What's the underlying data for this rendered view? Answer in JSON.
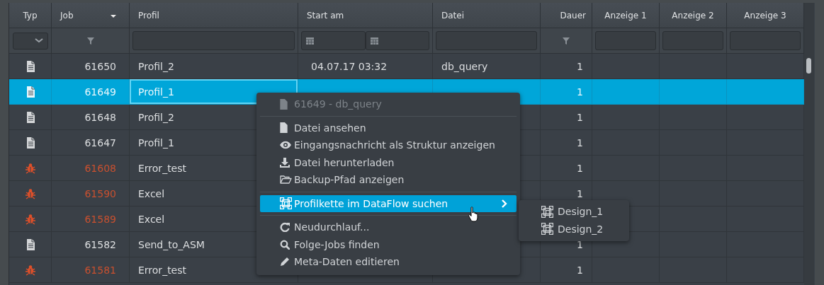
{
  "table": {
    "columns": [
      {
        "label": "Typ",
        "sorted": false
      },
      {
        "label": "Job",
        "sorted": true
      },
      {
        "label": "Profil",
        "sorted": false
      },
      {
        "label": "Start am",
        "sorted": false
      },
      {
        "label": "Datei",
        "sorted": false
      },
      {
        "label": "Dauer",
        "sorted": false
      },
      {
        "label": "Anzeige 1",
        "sorted": false
      },
      {
        "label": "Anzeige 2",
        "sorted": false
      },
      {
        "label": "Anzeige 3",
        "sorted": false
      }
    ],
    "filters": [
      {
        "kind": "select"
      },
      {
        "kind": "funnel"
      },
      {
        "kind": "text"
      },
      {
        "kind": "date-range"
      },
      {
        "kind": "text"
      },
      {
        "kind": "funnel"
      },
      {
        "kind": "text"
      },
      {
        "kind": "text"
      },
      {
        "kind": "text"
      }
    ],
    "rows": [
      {
        "kind": "file",
        "selected": false,
        "focused": false,
        "job": "61650",
        "profil": "Profil_2",
        "start": "04.07.17 03:32",
        "datei": "db_query",
        "dauer": "1"
      },
      {
        "kind": "file",
        "selected": true,
        "focused": true,
        "job": "61649",
        "profil": "Profil_1",
        "dauer": "1"
      },
      {
        "kind": "file",
        "selected": false,
        "focused": false,
        "job": "61648",
        "profil": "Profil_2",
        "dauer": "1"
      },
      {
        "kind": "file",
        "selected": false,
        "focused": false,
        "job": "61647",
        "profil": "Profil_1",
        "dauer": "1"
      },
      {
        "kind": "error",
        "selected": false,
        "focused": false,
        "job": "61608",
        "profil": "Error_test",
        "dauer": "1"
      },
      {
        "kind": "error",
        "selected": false,
        "focused": false,
        "job": "61590",
        "profil": "Excel",
        "dauer": "1"
      },
      {
        "kind": "error",
        "selected": false,
        "focused": false,
        "job": "61589",
        "profil": "Excel"
      },
      {
        "kind": "file",
        "selected": false,
        "focused": false,
        "job": "61582",
        "profil": "Send_to_ASM",
        "dauer": "1"
      },
      {
        "kind": "error",
        "selected": false,
        "focused": false,
        "job": "61581",
        "profil": "Error_test",
        "dauer": "1"
      }
    ]
  },
  "context_menu": {
    "items": [
      {
        "kind": "header",
        "label": "61649 - db_query",
        "selected": false
      },
      {
        "kind": "separator"
      },
      {
        "kind": "item",
        "label": "Datei ansehen",
        "selected": false
      },
      {
        "kind": "item",
        "label": "Eingangsnachricht als Struktur anzeigen",
        "selected": false
      },
      {
        "kind": "item",
        "label": "Datei herunterladen",
        "selected": false
      },
      {
        "kind": "item",
        "label": "Backup-Pfad anzeigen",
        "selected": false
      },
      {
        "kind": "separator"
      },
      {
        "kind": "submenu",
        "label": "Profilkette im DataFlow suchen",
        "selected": true
      },
      {
        "kind": "separator"
      },
      {
        "kind": "item",
        "label": "Neudurchlauf...",
        "selected": false
      },
      {
        "kind": "item",
        "label": "Folge-Jobs finden",
        "selected": false
      },
      {
        "kind": "item",
        "label": "Meta-Daten editieren",
        "selected": false
      }
    ],
    "submenu": {
      "items": [
        {
          "label": "Design_1",
          "selected": false
        },
        {
          "label": "Design_2",
          "selected": false
        }
      ]
    }
  }
}
